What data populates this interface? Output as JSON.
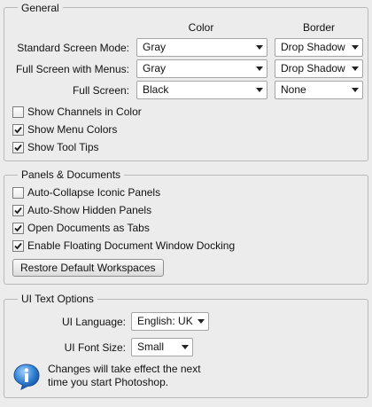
{
  "general": {
    "title": "General",
    "columns": {
      "color": "Color",
      "border": "Border"
    },
    "rows": [
      {
        "label": "Standard Screen Mode:",
        "color": "Gray",
        "border": "Drop Shadow"
      },
      {
        "label": "Full Screen with Menus:",
        "color": "Gray",
        "border": "Drop Shadow"
      },
      {
        "label": "Full Screen:",
        "color": "Black",
        "border": "None"
      }
    ],
    "checkboxes": [
      {
        "label": "Show Channels in Color",
        "checked": false
      },
      {
        "label": "Show Menu Colors",
        "checked": true
      },
      {
        "label": "Show Tool Tips",
        "checked": true
      }
    ]
  },
  "panels": {
    "title": "Panels & Documents",
    "checkboxes": [
      {
        "label": "Auto-Collapse Iconic Panels",
        "checked": false
      },
      {
        "label": "Auto-Show Hidden Panels",
        "checked": true
      },
      {
        "label": "Open Documents as Tabs",
        "checked": true
      },
      {
        "label": "Enable Floating Document Window Docking",
        "checked": true
      }
    ],
    "restore_button": "Restore Default Workspaces"
  },
  "ui_text": {
    "title": "UI Text Options",
    "language_label": "UI Language:",
    "language_value": "English: UK",
    "font_size_label": "UI Font Size:",
    "font_size_value": "Small",
    "note_line1": "Changes will take effect the next",
    "note_line2": "time you start Photoshop.",
    "note_icon": "info-icon"
  },
  "colors": {
    "info_blue": "#2f7fd0",
    "check": "#1b1b1b"
  }
}
